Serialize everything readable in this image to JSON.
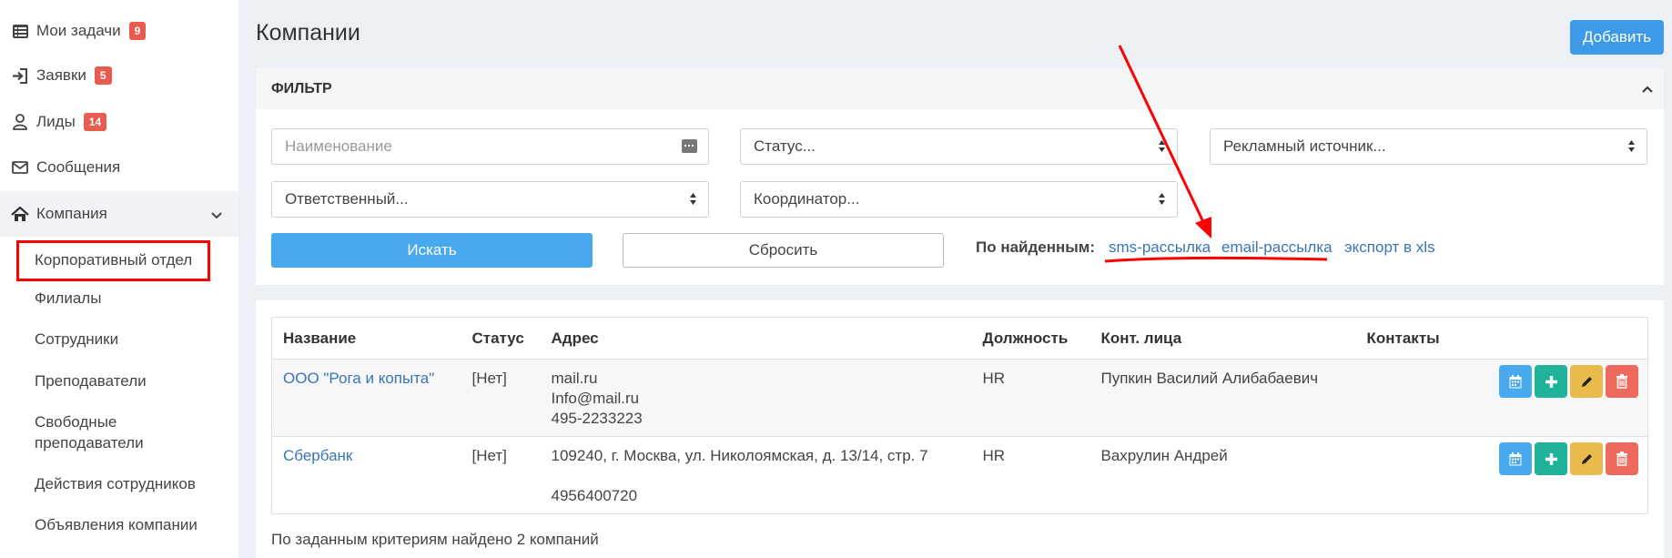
{
  "sidebar": {
    "items": [
      {
        "label": "Мои задачи",
        "badge": "9",
        "icon": "list-icon"
      },
      {
        "label": "Заявки",
        "badge": "5",
        "icon": "sign-in-icon"
      },
      {
        "label": "Лиды",
        "badge": "14",
        "icon": "user-icon"
      },
      {
        "label": "Сообщения",
        "badge": "",
        "icon": "envelope-icon"
      },
      {
        "label": "Компания",
        "badge": "",
        "icon": "home-icon"
      }
    ],
    "sub_items": [
      "Корпоративный отдел",
      "Филиалы",
      "Сотрудники",
      "Преподаватели",
      "Свободные",
      "преподаватели",
      "Действия сотрудников",
      "Объявления компании"
    ]
  },
  "header": {
    "title": "Компании",
    "add_label": "Добавить"
  },
  "filter": {
    "title": "ФИЛЬТР",
    "name_placeholder": "Наименование",
    "status": "Статус...",
    "ad_source": "Рекламный источник...",
    "responsible": "Ответственный...",
    "coordinator": "Координатор...",
    "search_label": "Искать",
    "reset_label": "Сбросить",
    "found_label": "По найденным:",
    "links": {
      "sms": "sms-рассылка",
      "email": "email-рассылка",
      "xls": "экспорт в xls"
    }
  },
  "table": {
    "columns": [
      "Название",
      "Статус",
      "Адрес",
      "Должность",
      "Конт. лица",
      "Контакты"
    ],
    "rows": [
      {
        "name": "ООО \"Рога и копыта\"",
        "status": "[Нет]",
        "address": [
          "mail.ru",
          "Info@mail.ru",
          "495-2233223"
        ],
        "position": "HR",
        "contact": "Пупкин Василий Алибабаевич"
      },
      {
        "name": "Сбербанк",
        "status": "[Нет]",
        "address": [
          "109240, г. Москва, ул. Николоямская, д. 13/14, стр. 7",
          "",
          "4956400720"
        ],
        "position": "HR",
        "contact": "Вахрулин Андрей"
      }
    ]
  },
  "summary": "По заданным критериям найдено 2 компаний",
  "colors": {
    "accent": "#3d9ae8",
    "badge": "#e85b4f",
    "annotation": "#ff0000"
  }
}
